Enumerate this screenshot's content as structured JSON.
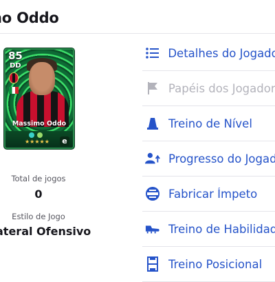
{
  "header": {
    "title": "no Oddo"
  },
  "card": {
    "rating": "85",
    "position": "DD",
    "player_name": "Massimo Oddo",
    "stars": "★★★★★",
    "brand_mark": "e"
  },
  "stats": {
    "total_games_label": "Total de jogos",
    "total_games_value": "0",
    "play_style_label": "Estilo de Jogo",
    "play_style_value": "ateral Ofensivo"
  },
  "menu": {
    "items": [
      {
        "label": "Detalhes do Jogado",
        "icon": "list-icon",
        "enabled": true
      },
      {
        "label": "Papéis dos Jogador",
        "icon": "flag-icon",
        "enabled": false
      },
      {
        "label": "Treino de Nível",
        "icon": "cone-icon",
        "enabled": true
      },
      {
        "label": "Progresso do Jogad",
        "icon": "user-progress-icon",
        "enabled": true
      },
      {
        "label": "Fabricar Ímpeto",
        "icon": "momentum-icon",
        "enabled": true
      },
      {
        "label": "Treino de Habilidade",
        "icon": "boot-icon",
        "enabled": true
      },
      {
        "label": "Treino Posicional",
        "icon": "pitch-icon",
        "enabled": true
      }
    ]
  },
  "colors": {
    "accent": "#2553c9",
    "disabled": "#b3b3bb",
    "divider": "#e4e4ea"
  }
}
